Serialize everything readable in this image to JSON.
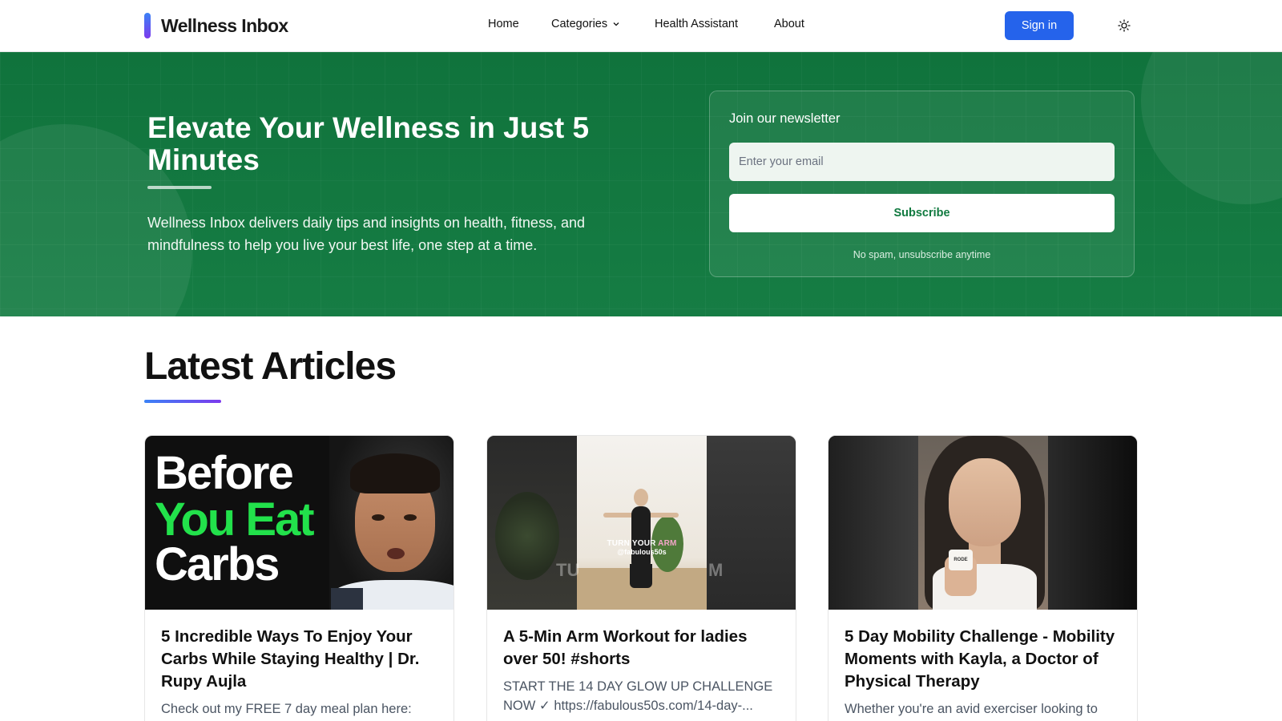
{
  "header": {
    "logo_text": "Wellness Inbox",
    "nav": {
      "home": "Home",
      "categories": "Categories",
      "health_assistant": "Health Assistant",
      "about": "About"
    },
    "sign_in": "Sign in"
  },
  "hero": {
    "title": "Elevate Your Wellness in Just 5 Minutes",
    "description": "Wellness Inbox delivers daily tips and insights on health, fitness, and mindfulness to help you live your best life, one step at a time.",
    "newsletter": {
      "title": "Join our newsletter",
      "email_placeholder": "Enter your email",
      "subscribe_label": "Subscribe",
      "note": "No spam, unsubscribe anytime"
    }
  },
  "latest": {
    "title": "Latest Articles",
    "articles": [
      {
        "title": "5 Incredible Ways To Enjoy Your Carbs While Staying Healthy | Dr. Rupy Aujla",
        "description": "Check out my FREE 7 day meal plan here:",
        "thumb_text": [
          "Before",
          "You Eat",
          "Carbs"
        ]
      },
      {
        "title": "A 5-Min Arm Workout for ladies over 50! #shorts",
        "description": "START THE 14 DAY GLOW UP CHALLENGE NOW ✓ https://fabulous50s.com/14-day-...",
        "thumb_caption_a": "TURN YOUR",
        "thumb_caption_b": "ARM",
        "thumb_handle": "@fabulous50s",
        "thumb_ghost_left": "TU",
        "thumb_ghost_right": "M"
      },
      {
        "title": "5 Day Mobility Challenge - Mobility Moments with Kayla, a Doctor of Physical Therapy",
        "description": "Whether you're an avid exerciser looking to",
        "thumb_label": "RODE"
      }
    ]
  },
  "colors": {
    "primary_blue": "#2563eb",
    "hero_green": "#117a40",
    "accent_green": "#22e14b"
  },
  "icons": {
    "chevron": "chevron-down-icon",
    "theme": "sun-icon"
  }
}
